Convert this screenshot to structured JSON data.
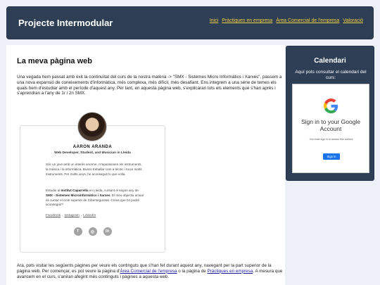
{
  "header": {
    "title": "Projecte Intermodular",
    "nav": [
      "Inici",
      "Pràctiques en empresa",
      "Àrea Comercial de l'empresa",
      "Valoració"
    ]
  },
  "main": {
    "heading": "La meva pàgina web",
    "intro": "Una vegada hem passat amb èxit la continuïtat del curs de la nostra matèria -> \"SMX - Sistemes Micro Informàtics i Xarxes\", passem a una nova expansió de coneixements d'informàtica, més complexa, més difícil, més desafiant. Ens integrem a una sèrie de temes els quals hem d'estudiar amb el període d'aquest any. Per tant, en aquesta pàgina web, s'explicaran tots els elements que s'han après i s'aprendran a l'any de 1r i 2n SMX.",
    "footer": {
      "before_link1": "Ara, pots visitar les següents pàgines per veure els continguts que s'han fet durant aquest any, navegant per la part superior de la pàgina web. Per començar, es pot veure la pàgina d'",
      "link1": "Àrea Comercial de l'empresa",
      "between": " o la pàgina de ",
      "link2": "Pràctiques en empresa",
      "after": ". A mesura que avancem en el curs, s'aniran afegint més continguts i pàgines a aquesta web."
    }
  },
  "profile": {
    "name": "AARON ARANDA",
    "role": "Web Developer, Student, and Musician in Lleida",
    "bio1": "Sóc un jove amb un interès enorme, m'apassionen els instruments, la música i la informàtica. Busco treballar com a tècnic i tocar molts instruments. Per molts anys, he aconseguit lo que volia.",
    "bio2_pre": "Estudio al ",
    "bio2_school": "Institut Caparrella",
    "bio2_mid": " en Lleida, cursant el segon any de ",
    "bio2_course": "SMX - Sistemes Microinformàtics i Xarxes",
    "bio2_post": ". El meu objectiu actual és cursar el cicle superior de Ciberseguretat. Creus que ho podré aconseguir?",
    "links": [
      "Facebook",
      "Instagram",
      "LinkedIn"
    ],
    "social_icons": [
      "facebook-icon",
      "instagram-icon",
      "linkedin-icon"
    ]
  },
  "calendar": {
    "title": "Calendari",
    "description": "Aquí pots consultar el calendari del curs:",
    "signin_title": "Sign in to your Google Account",
    "signin_note": "You must sign in to access this content.",
    "signin_button": "Sign in"
  },
  "colors": {
    "header_bg": "#2e3e55",
    "nav_link": "#f4d03f",
    "link": "#1a1aa6",
    "google_blue": "#1a73e8"
  }
}
